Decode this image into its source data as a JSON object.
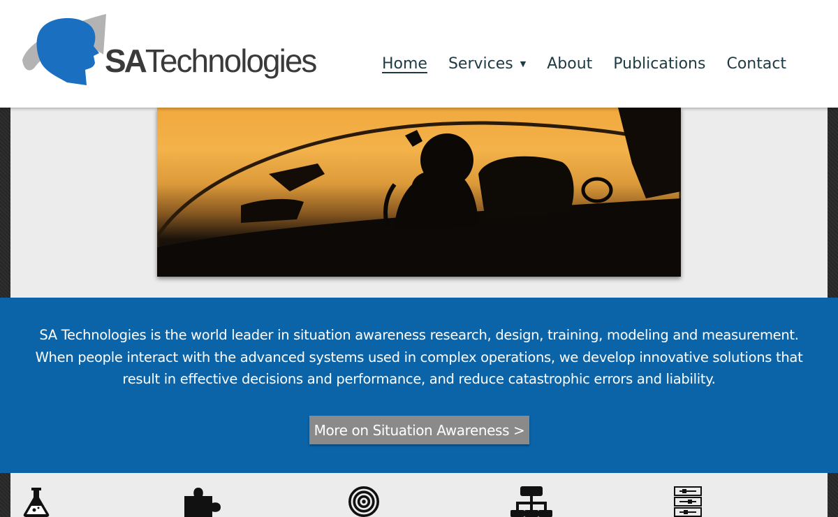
{
  "header": {
    "logo_text_bold": "SA",
    "logo_text_regular": "Technologies",
    "logo_alt": "SA Technologies"
  },
  "nav": {
    "items": [
      {
        "label": "Home",
        "active": true
      },
      {
        "label": "Services",
        "has_dropdown": true
      },
      {
        "label": "About"
      },
      {
        "label": "Publications"
      },
      {
        "label": "Contact"
      }
    ]
  },
  "hero": {
    "image": "fighter-pilot-cockpit-silhouette-at-sunset"
  },
  "intro": {
    "text": "SA Technologies is the world leader in situation awareness research, design, training, modeling and measurement. When people interact with the advanced systems used in complex operations, we develop innovative solutions that result in effective decisions and performance, and reduce catastrophic errors and liability.",
    "cta_label": "More on Situation Awareness >"
  },
  "services_icons": [
    {
      "icon": "flask-icon"
    },
    {
      "icon": "puzzle-piece-icon"
    },
    {
      "icon": "target-icon"
    },
    {
      "icon": "sitemap-icon"
    },
    {
      "icon": "server-rack-icon"
    }
  ],
  "colors": {
    "brand_blue": "#0b64a8",
    "logo_blue": "#1a6fc1",
    "nav_text": "#1d3a44",
    "cta_gray": "#8a8a8a",
    "panel_gray": "#ececec"
  }
}
